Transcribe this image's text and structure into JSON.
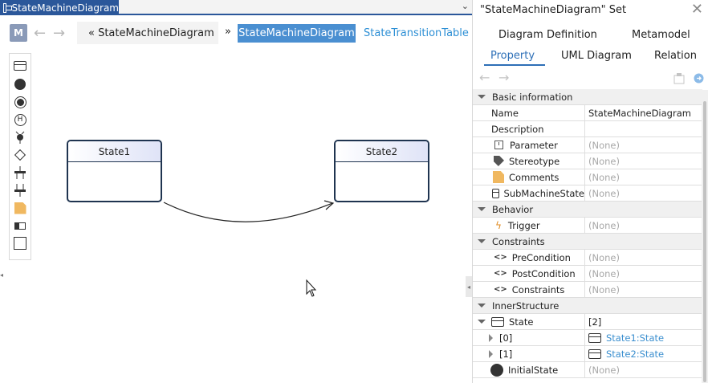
{
  "editor": {
    "tab_title": "StateMachineDiagram",
    "breadcrumb": "« StateMachineDiagram",
    "breadcrumb_separator": "»",
    "active_view": "StateMachineDiagram",
    "other_view": "StateTransitionTable",
    "m_button": "M",
    "back_arrow": "←",
    "forward_arrow": "→",
    "states": [
      {
        "label": "State1"
      },
      {
        "label": "State2"
      }
    ],
    "palette_icons": [
      "state-icon",
      "initial-state-icon",
      "final-state-icon",
      "history-icon",
      "junction-icon",
      "choice-icon",
      "fork-icon",
      "join-icon",
      "comment-icon",
      "submachine-icon",
      "frame-icon"
    ]
  },
  "panel": {
    "title": "\"StateMachineDiagram\" Set",
    "close": "✕",
    "tabs_row1": [
      "Diagram Definition",
      "Metamodel"
    ],
    "tabs_row2": [
      "Property",
      "UML Diagram",
      "Relation"
    ],
    "active_tab": "Property",
    "back_arrow": "←",
    "forward_arrow": "→",
    "sections": {
      "basic": "Basic information",
      "behavior": "Behavior",
      "constraints": "Constraints",
      "inner": "InnerStructure"
    },
    "rows": {
      "name": {
        "label": "Name",
        "value": "StateMachineDiagram"
      },
      "description": {
        "label": "Description",
        "value": ""
      },
      "parameter": {
        "label": "Parameter",
        "value": "(None)"
      },
      "stereotype": {
        "label": "Stereotype",
        "value": "(None)"
      },
      "comments": {
        "label": "Comments",
        "value": "(None)"
      },
      "submachine": {
        "label": "SubMachineState",
        "value": "(None)"
      },
      "trigger": {
        "label": "Trigger",
        "value": "(None)"
      },
      "precondition": {
        "label": "PreCondition",
        "value": "(None)"
      },
      "postcondition": {
        "label": "PostCondition",
        "value": "(None)"
      },
      "constraints": {
        "label": "Constraints",
        "value": "(None)"
      },
      "state": {
        "label": "State",
        "value": "[2]"
      },
      "state0": {
        "label": "[0]",
        "value": "State1:State"
      },
      "state1": {
        "label": "[1]",
        "value": "State2:State"
      },
      "initial": {
        "label": "InitialState",
        "value": "(None)"
      }
    }
  }
}
